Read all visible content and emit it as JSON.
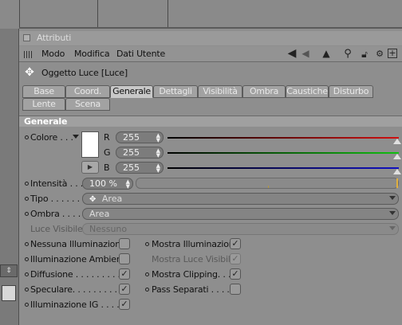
{
  "panel_title": "Attributi",
  "menu": [
    "Modo",
    "Modifica",
    "Dati Utente"
  ],
  "toolbar_icons": [
    "arrow-left-icon",
    "arrow-up-icon",
    "search-icon",
    "lock-icon",
    "settings-icon",
    "add-icon"
  ],
  "object_title": "Oggetto Luce [Luce]",
  "tabs_row1": [
    "Base",
    "Coord.",
    "Generale",
    "Dettagli",
    "Visibilità",
    "Ombra",
    "Caustiche",
    "Disturbo"
  ],
  "tabs_row2": [
    "Lente",
    "Scena"
  ],
  "active_tab": "Generale",
  "section_title": "Generale",
  "color": {
    "label": "Colore . . .",
    "swatch": "#ffffff",
    "channels": [
      {
        "name": "R",
        "value": "255",
        "track": "#d01010"
      },
      {
        "name": "G",
        "value": "255",
        "track": "#10c010"
      },
      {
        "name": "B",
        "value": "255",
        "track": "#1010c0"
      }
    ],
    "slider_levels": [
      1.0,
      1.0,
      1.0
    ]
  },
  "intensity": {
    "label": "Intensità . . .",
    "value": "100 %",
    "level": 1.0
  },
  "tipo": {
    "label": "Tipo . . . . . .",
    "value": "Area",
    "icon": "area-light-icon"
  },
  "ombra": {
    "label": "Ombra . . . . .",
    "value": "Area"
  },
  "luce_visibile": {
    "label": "Luce Visibile",
    "value": "Nessuno"
  },
  "checks_left": [
    {
      "label": "Nessuna Illuminazione",
      "checked": false,
      "dim": false
    },
    {
      "label": "Illuminazione Ambiente",
      "checked": false,
      "dim": false
    },
    {
      "label": "Diffusione . . . . . . . . . .",
      "checked": true,
      "dim": false
    },
    {
      "label": "Speculare. . . . . . . . . . .",
      "checked": true,
      "dim": false
    },
    {
      "label": "Illuminazione IG . . . .",
      "checked": true,
      "dim": false
    }
  ],
  "checks_right": [
    {
      "label": "Mostra Illuminazione",
      "checked": true,
      "dim": false
    },
    {
      "label": "Mostra Luce Visibile",
      "checked": true,
      "dim": true
    },
    {
      "label": "Mostra Clipping. . . .",
      "checked": true,
      "dim": false
    },
    {
      "label": "Pass Separati . . . . .",
      "checked": false,
      "dim": false
    }
  ],
  "check_mark": "✓",
  "colors": {
    "panel_bg": "#8e8e8e",
    "header_bg": "#9e9e9e",
    "active_tab": "#c8c8c8",
    "dark_strip": "#2c2c2c"
  }
}
